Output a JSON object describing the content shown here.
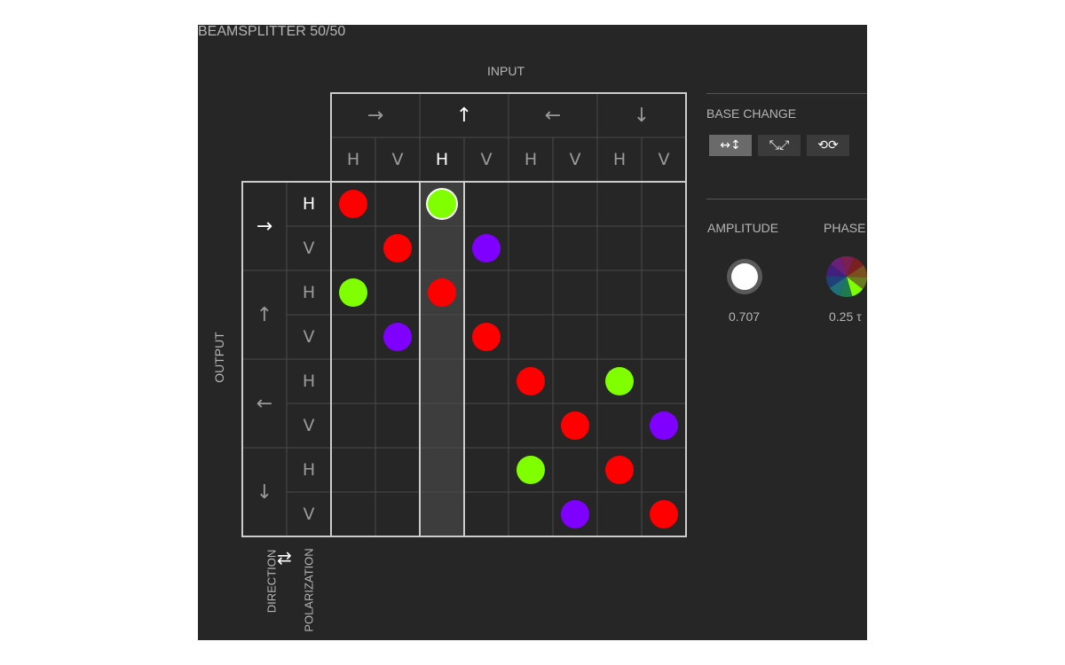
{
  "title": "BEAMSPLITTER 50/50",
  "input_label": "INPUT",
  "output_label": "OUTPUT",
  "directions": [
    "→",
    "↑",
    "←",
    "↓"
  ],
  "polarizations": [
    "H",
    "V"
  ],
  "axis_toggle": {
    "direction_label": "DIRECTION",
    "swap_icon": "⇄",
    "polarization_label": "POLARIZATION"
  },
  "selected": {
    "row": 0,
    "col": 2
  },
  "colors": {
    "red": "#ff0000",
    "green": "#7fff00",
    "purple": "#8000ff",
    "grid_line": "#4a4a4a",
    "frame": "#cccccc",
    "highlight_column": "#3d3d3d"
  },
  "matrix": [
    [
      "red",
      null,
      "green",
      null,
      null,
      null,
      null,
      null
    ],
    [
      null,
      "red",
      null,
      "purple",
      null,
      null,
      null,
      null
    ],
    [
      "green",
      null,
      "red",
      null,
      null,
      null,
      null,
      null
    ],
    [
      null,
      "purple",
      null,
      "red",
      null,
      null,
      null,
      null
    ],
    [
      null,
      null,
      null,
      null,
      "red",
      null,
      "green",
      null
    ],
    [
      null,
      null,
      null,
      null,
      null,
      "red",
      null,
      "purple"
    ],
    [
      null,
      null,
      null,
      null,
      "green",
      null,
      "red",
      null
    ],
    [
      null,
      null,
      null,
      null,
      null,
      "purple",
      null,
      "red"
    ]
  ],
  "base_change": {
    "label": "BASE CHANGE",
    "buttons": [
      {
        "name": "horizontal-vertical",
        "glyph": "↔↕",
        "active": true
      },
      {
        "name": "diagonal",
        "glyph": "⤡⤢",
        "active": false
      },
      {
        "name": "circular",
        "glyph": "⟲⟳",
        "active": false
      }
    ]
  },
  "amplitude": {
    "label": "AMPLITUDE",
    "value": "0.707"
  },
  "phase": {
    "label": "PHASE",
    "value": "0.25 τ"
  }
}
